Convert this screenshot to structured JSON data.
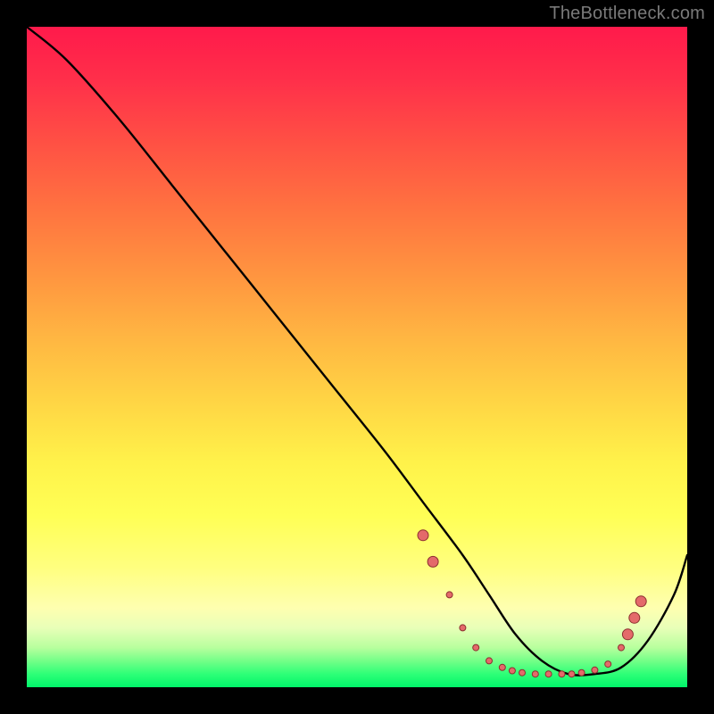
{
  "watermark": "TheBottleneck.com",
  "chart_data": {
    "type": "line",
    "title": "",
    "xlabel": "",
    "ylabel": "",
    "xlim": [
      0,
      100
    ],
    "ylim": [
      0,
      100
    ],
    "background_gradient": {
      "top": "#ff1a4b",
      "middle": "#ffff55",
      "bottom": "#00f56a"
    },
    "series": [
      {
        "name": "curve",
        "x": [
          0,
          6,
          14,
          22,
          30,
          38,
          46,
          54,
          60,
          66,
          70,
          74,
          78,
          82,
          86,
          90,
          94,
          98,
          100
        ],
        "y": [
          100,
          95,
          86,
          76,
          66,
          56,
          46,
          36,
          28,
          20,
          14,
          8,
          4,
          2,
          2,
          3,
          7,
          14,
          20
        ]
      }
    ],
    "markers": [
      {
        "x": 60,
        "y": 23
      },
      {
        "x": 61.5,
        "y": 19
      },
      {
        "x": 64,
        "y": 14
      },
      {
        "x": 66,
        "y": 9
      },
      {
        "x": 68,
        "y": 6
      },
      {
        "x": 70,
        "y": 4
      },
      {
        "x": 72,
        "y": 3
      },
      {
        "x": 73.5,
        "y": 2.5
      },
      {
        "x": 75,
        "y": 2.2
      },
      {
        "x": 77,
        "y": 2
      },
      {
        "x": 79,
        "y": 2
      },
      {
        "x": 81,
        "y": 2
      },
      {
        "x": 82.5,
        "y": 2
      },
      {
        "x": 84,
        "y": 2.2
      },
      {
        "x": 86,
        "y": 2.6
      },
      {
        "x": 88,
        "y": 3.5
      },
      {
        "x": 90,
        "y": 6
      },
      {
        "x": 91,
        "y": 8
      },
      {
        "x": 92,
        "y": 10.5
      },
      {
        "x": 93,
        "y": 13
      }
    ],
    "marker_style": {
      "fill": "#e46a6a",
      "stroke": "#8c2f2f",
      "r_small": 3.5,
      "r_large": 6
    }
  }
}
